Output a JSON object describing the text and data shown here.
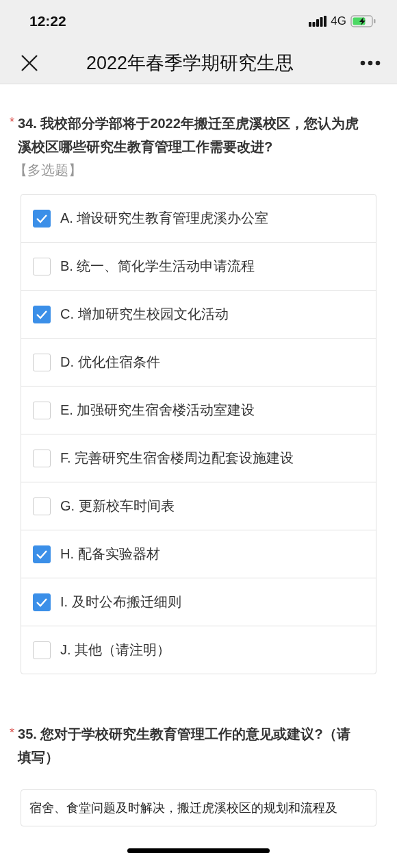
{
  "status_bar": {
    "time": "12:22",
    "network": "4G"
  },
  "nav_bar": {
    "title": "2022年春季学期研究生思"
  },
  "questions": [
    {
      "kind": "multiple",
      "required_mark": "*",
      "text": "34. 我校部分学部将于2022年搬迁至虎溪校区，您认为虎溪校区哪些研究生教育管理工作需要改进?",
      "tag": "【多选题】",
      "options": [
        {
          "label": "A. 增设研究生教育管理虎溪办公室",
          "checked": true
        },
        {
          "label": "B. 统一、简化学生活动申请流程",
          "checked": false
        },
        {
          "label": "C. 增加研究生校园文化活动",
          "checked": true
        },
        {
          "label": "D. 优化住宿条件",
          "checked": false
        },
        {
          "label": "E. 加强研究生宿舍楼活动室建设",
          "checked": false
        },
        {
          "label": "F. 完善研究生宿舍楼周边配套设施建设",
          "checked": false
        },
        {
          "label": "G. 更新校车时间表",
          "checked": false
        },
        {
          "label": "H. 配备实验器材",
          "checked": true
        },
        {
          "label": "I. 及时公布搬迁细则",
          "checked": true
        },
        {
          "label": "J. 其他（请注明）",
          "checked": false
        }
      ]
    },
    {
      "kind": "text",
      "required_mark": "*",
      "text": "35. 您对于学校研究生教育管理工作的意见或建议?（请填写）",
      "value": "宿舍、食堂问题及时解决，搬迁虎溪校区的规划和流程及"
    }
  ]
}
